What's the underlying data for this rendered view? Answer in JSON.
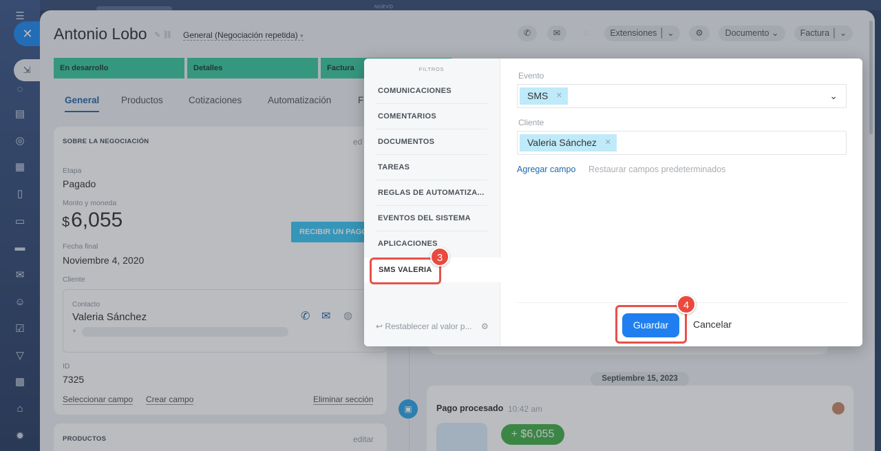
{
  "topbar": {
    "nuevo": "NUEVO"
  },
  "deal": {
    "title": "Antonio Lobo",
    "pipeline": "General (Negociación repetida)",
    "header_buttons": {
      "extensions": "Extensiones",
      "document": "Documento",
      "invoice": "Factura"
    }
  },
  "stages": [
    "En desarrollo",
    "Detalles",
    "Factura"
  ],
  "tabs": [
    "General",
    "Productos",
    "Cotizaciones",
    "Automatización",
    "F"
  ],
  "about": {
    "section_title": "SOBRE LA NEGOCIACIÓN",
    "edit": "ed",
    "stage_label": "Etapa",
    "stage_value": "Pagado",
    "amount_label": "Monto y moneda",
    "currency": "$",
    "amount": "6,055",
    "receive_payment": "RECIBIR UN PAGO",
    "end_date_label": "Fecha final",
    "end_date": "Noviembre 4, 2020",
    "client_label": "Cliente",
    "contact_label": "Contacto",
    "contact_name": "Valeria Sánchez",
    "contact_phone_prefix": "+",
    "id_label": "ID",
    "id_value": "7325",
    "select_field": "Seleccionar campo",
    "create_field": "Crear campo",
    "delete_section": "Eliminar sección"
  },
  "products": {
    "section_title": "PRODUCTOS",
    "edit": "editar"
  },
  "timeline": {
    "date": "Septiembre 15, 2023",
    "event_title": "Pago procesado",
    "event_time": "10:42 am",
    "event_amount": "+ $6,055"
  },
  "filter_modal": {
    "header": "FILTROS",
    "menu_items": [
      "COMUNICACIONES",
      "COMENTARIOS",
      "DOCUMENTOS",
      "TAREAS",
      "REGLAS DE AUTOMATIZA...",
      "EVENTOS DEL SISTEMA",
      "APLICACIONES"
    ],
    "active_item": "SMS VALERIA",
    "reset": "Restablecer al valor p...",
    "event_label": "Evento",
    "event_chip": "SMS",
    "client_label": "Cliente",
    "client_chip": "Valeria Sánchez",
    "add_field": "Agregar campo",
    "restore_fields": "Restaurar campos predeterminados",
    "save": "Guardar",
    "cancel": "Cancelar"
  },
  "steps": {
    "three": "3",
    "four": "4"
  },
  "colors": {
    "stage_green": "#3dc9a1",
    "primary_blue": "#1f7ff0",
    "highlight_red": "#e8504a",
    "chip_blue": "#bfeafa",
    "payment_green": "#46b04b"
  }
}
